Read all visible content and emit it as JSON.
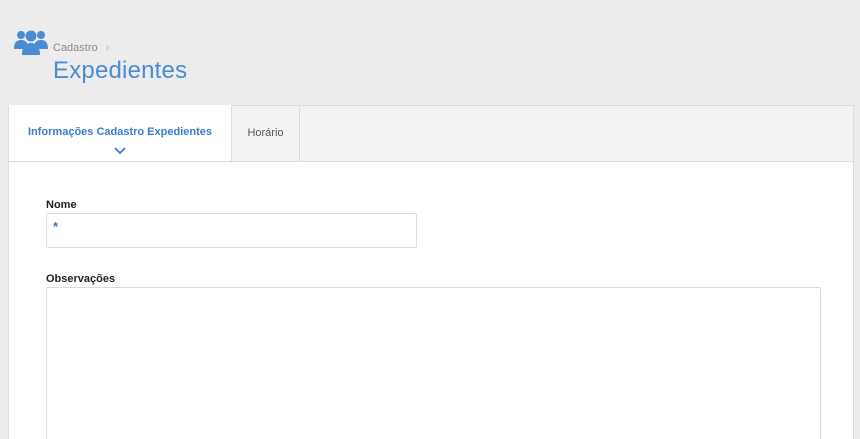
{
  "header": {
    "icon": "users-icon",
    "breadcrumb": "Cadastro",
    "breadcrumb_separator": "›",
    "title": "Expedientes"
  },
  "tabs": [
    {
      "label": "Informações Cadastro Expedientes",
      "active": true
    },
    {
      "label": "Horário",
      "active": false
    }
  ],
  "form": {
    "nome": {
      "label": "Nome",
      "required_marker": "*",
      "value": ""
    },
    "observacoes": {
      "label": "Observações",
      "value": ""
    }
  },
  "colors": {
    "accent": "#4a8bd4",
    "background": "#ececec",
    "border": "#dcdcdc"
  }
}
